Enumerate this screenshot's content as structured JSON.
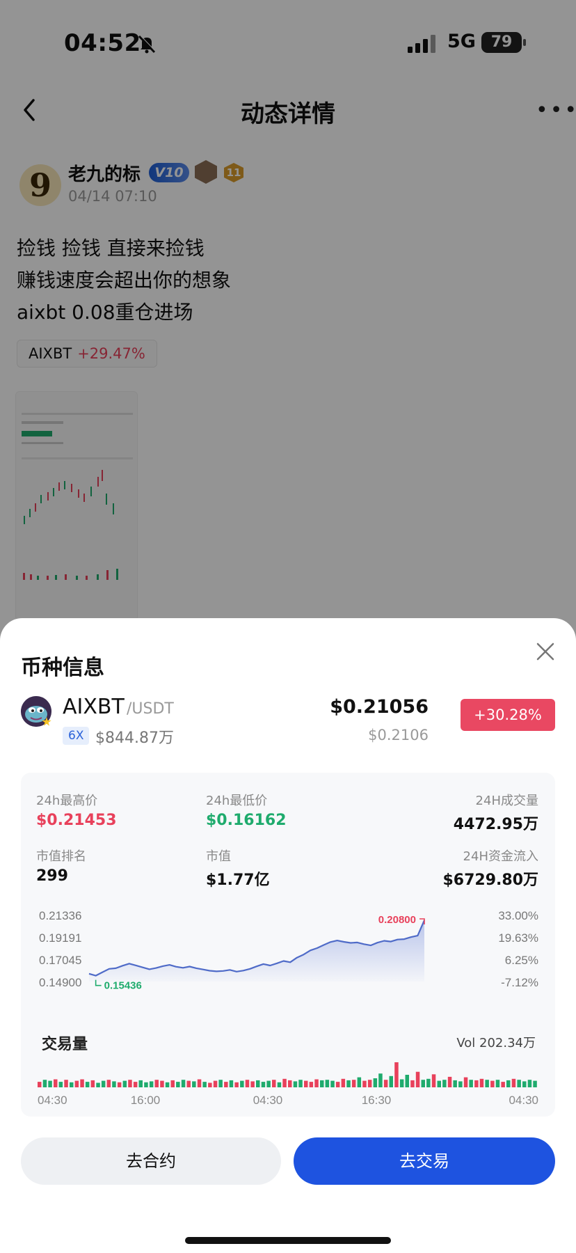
{
  "status_bar": {
    "time": "04:52",
    "network": "5G",
    "battery": "79"
  },
  "nav": {
    "title": "动态详情"
  },
  "post": {
    "author": "老九的标",
    "avatar_text": "9",
    "vip": "V10",
    "level": "11",
    "time": "04/14 07:10",
    "lines": [
      "捡钱 捡钱 直接来捡钱",
      "赚钱速度会超出你的想象",
      "aixbt 0.08重仓进场"
    ],
    "chip": {
      "symbol": "AIXBT",
      "change": "+29.47%"
    }
  },
  "sheet": {
    "title": "币种信息",
    "coin": {
      "symbol": "AIXBT",
      "quote": "/USDT",
      "leverage": "6X",
      "market_cap_small": "$844.87万",
      "price": "$0.21056",
      "price_sub": "$0.2106",
      "change": "+30.28%"
    },
    "stats": {
      "high_label": "24h最高价",
      "high": "$0.21453",
      "low_label": "24h最低价",
      "low": "$0.16162",
      "vol_label": "24H成交量",
      "vol": "4472.95万",
      "rank_label": "市值排名",
      "rank": "299",
      "mcap_label": "市值",
      "mcap": "$1.77亿",
      "flow_label": "24H资金流入",
      "flow": "$6729.80万"
    },
    "volume": {
      "title": "交易量",
      "total": "Vol 202.34万"
    },
    "buttons": {
      "contract": "去合约",
      "trade": "去交易"
    }
  },
  "chart_data": {
    "type": "area",
    "y_ticks": [
      "0.21336",
      "0.19191",
      "0.17045",
      "0.14900"
    ],
    "y_ticks_pct": [
      "33.00%",
      "19.63%",
      "6.25%",
      "-7.12%"
    ],
    "x_ticks": [
      "04:30",
      "16:00",
      "04:30",
      "16:30",
      "04:30"
    ],
    "ylim": [
      0.149,
      0.21336
    ],
    "max_label": "0.20800",
    "min_label": "0.15436",
    "price": [
      0.1565,
      0.1546,
      0.158,
      0.1612,
      0.1618,
      0.1642,
      0.1662,
      0.1645,
      0.1626,
      0.1608,
      0.162,
      0.1638,
      0.165,
      0.1632,
      0.1622,
      0.1634,
      0.1618,
      0.1606,
      0.1594,
      0.1588,
      0.1592,
      0.1602,
      0.1585,
      0.1595,
      0.1612,
      0.1636,
      0.1658,
      0.1644,
      0.1665,
      0.1688,
      0.1676,
      0.172,
      0.175,
      0.179,
      0.1812,
      0.1842,
      0.187,
      0.1885,
      0.1872,
      0.1862,
      0.1866,
      0.185,
      0.1838,
      0.1864,
      0.1882,
      0.1875,
      0.1894,
      0.1898,
      0.1918,
      0.1932,
      0.208
    ],
    "volume_heights": [
      0.22,
      0.3,
      0.26,
      0.32,
      0.22,
      0.3,
      0.2,
      0.26,
      0.32,
      0.22,
      0.28,
      0.18,
      0.26,
      0.3,
      0.24,
      0.2,
      0.26,
      0.3,
      0.22,
      0.28,
      0.2,
      0.24,
      0.3,
      0.26,
      0.2,
      0.28,
      0.22,
      0.3,
      0.26,
      0.24,
      0.32,
      0.22,
      0.18,
      0.26,
      0.3,
      0.22,
      0.28,
      0.2,
      0.26,
      0.3,
      0.24,
      0.28,
      0.22,
      0.26,
      0.3,
      0.2,
      0.34,
      0.28,
      0.24,
      0.3,
      0.26,
      0.22,
      0.32,
      0.28,
      0.3,
      0.26,
      0.22,
      0.34,
      0.28,
      0.3,
      0.4,
      0.26,
      0.3,
      0.36,
      0.55,
      0.3,
      0.45,
      1.0,
      0.32,
      0.5,
      0.28,
      0.62,
      0.3,
      0.34,
      0.52,
      0.26,
      0.3,
      0.42,
      0.28,
      0.24,
      0.4,
      0.3,
      0.28,
      0.34,
      0.3,
      0.26,
      0.3,
      0.22,
      0.28,
      0.34,
      0.3,
      0.24,
      0.3,
      0.26
    ],
    "volume_colors": "rggrgrgrrgrggrgrgrrgggrrgrggrgrgrrgrgrgrrgggrgrrggrrrgggrrgrgrrggrgrggrrggrggrggrgrrgrgrgrgggg"
  },
  "colors": {
    "up": "#e8415b",
    "down": "#1fab6d",
    "accent": "#1e53e0",
    "line": "#4f6bc8"
  }
}
